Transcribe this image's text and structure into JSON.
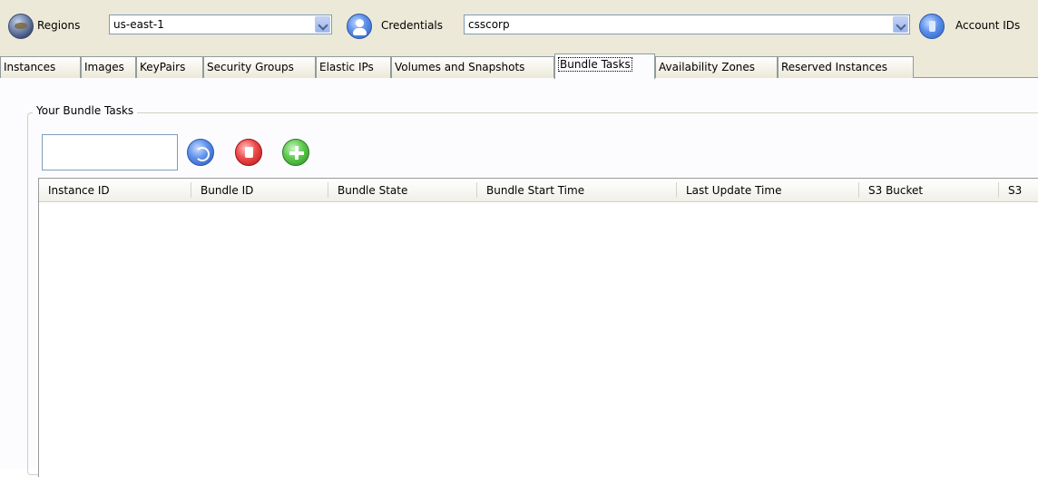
{
  "toolbar": {
    "regions_label": "Regions",
    "region_value": "us-east-1",
    "credentials_label": "Credentials",
    "credentials_value": "csscorp",
    "account_ids_label": "Account IDs"
  },
  "tabs": [
    {
      "label": "Instances"
    },
    {
      "label": "Images"
    },
    {
      "label": "KeyPairs"
    },
    {
      "label": "Security Groups"
    },
    {
      "label": "Elastic IPs"
    },
    {
      "label": "Volumes and Snapshots"
    },
    {
      "label": "Bundle Tasks",
      "active": true
    },
    {
      "label": "Availability Zones"
    },
    {
      "label": "Reserved Instances"
    }
  ],
  "group": {
    "title": "Your Bundle Tasks"
  },
  "search": {
    "value": ""
  },
  "actions": {
    "refresh_icon": "refresh-icon",
    "delete_icon": "delete-icon",
    "add_icon": "add-icon"
  },
  "table": {
    "columns": [
      "Instance ID",
      "Bundle ID",
      "Bundle State",
      "Bundle Start Time",
      "Last Update Time",
      "S3 Bucket",
      "S3"
    ],
    "rows": []
  },
  "colors": {
    "chrome": "#ece9d8",
    "content_bg": "#fcfcfe",
    "border": "#7f9db9"
  }
}
